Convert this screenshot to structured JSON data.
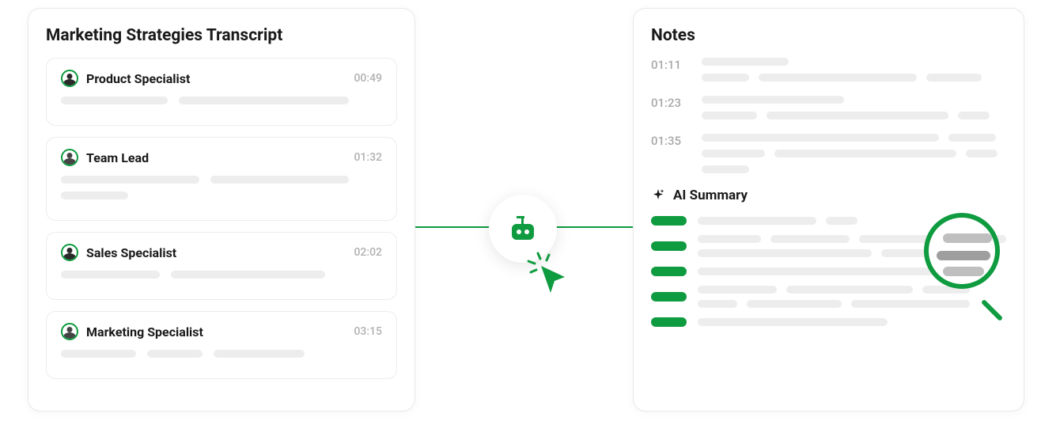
{
  "colors": {
    "accent": "#0f9b3f",
    "placeholder": "#ededed",
    "placeholder_dark": "#bfbfbf",
    "text": "#1a1a1a",
    "muted": "#a8a8a8"
  },
  "transcript": {
    "title": "Marketing Strategies Transcript",
    "entries": [
      {
        "speaker": "Product Specialist",
        "timestamp": "00:49"
      },
      {
        "speaker": "Team Lead",
        "timestamp": "01:32"
      },
      {
        "speaker": "Sales Specialist",
        "timestamp": "02:02"
      },
      {
        "speaker": "Marketing Specialist",
        "timestamp": "03:15"
      }
    ]
  },
  "notes": {
    "title": "Notes",
    "items": [
      {
        "timestamp": "01:11"
      },
      {
        "timestamp": "01:23"
      },
      {
        "timestamp": "01:35"
      }
    ]
  },
  "ai_summary": {
    "title": "AI Summary",
    "icon": "sparkle-icon"
  },
  "center": {
    "icon": "robot-icon",
    "cursor_icon": "cursor-click-icon"
  }
}
